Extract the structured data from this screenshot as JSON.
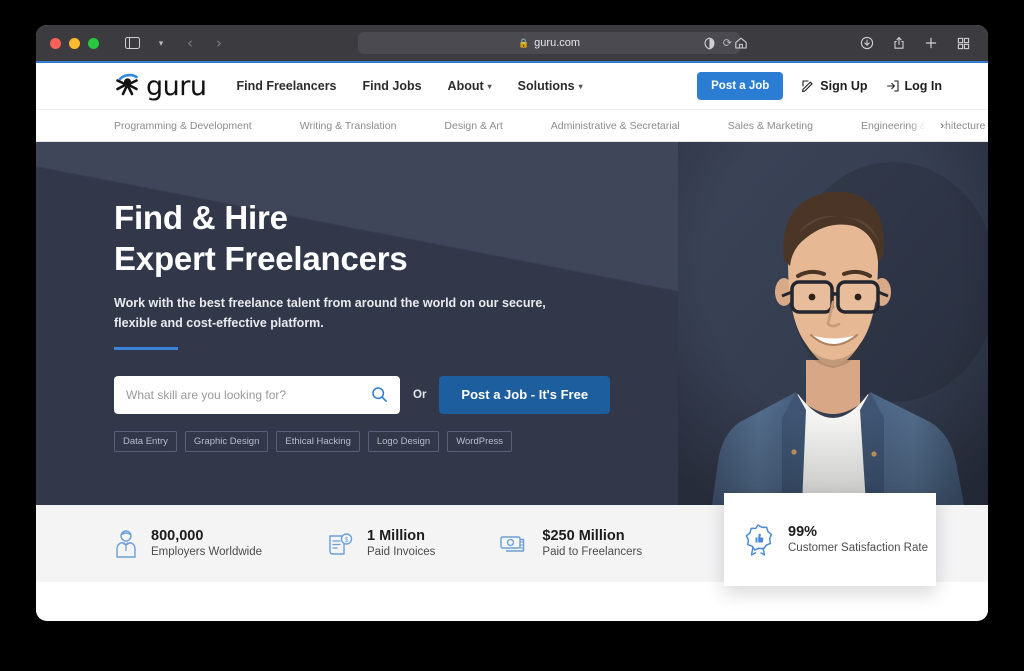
{
  "browser": {
    "url": "guru.com",
    "lock_icon": "lock-icon",
    "reload_icon": "reload-icon",
    "sidebar_icon": "sidebar-toggle-icon",
    "sidebar_caret_icon": "chevron-down-icon",
    "back_icon": "back-arrow-icon",
    "forward_icon": "forward-arrow-icon",
    "reader_icon": "reader-contrast-icon",
    "home_icon": "home-icon",
    "downloads_icon": "downloads-icon",
    "share_icon": "share-icon",
    "newtab_icon": "plus-icon",
    "tabs_icon": "tab-overview-icon"
  },
  "header": {
    "logo_text": "guru",
    "nav": [
      {
        "label": "Find Freelancers",
        "caret": false
      },
      {
        "label": "Find Jobs",
        "caret": false
      },
      {
        "label": "About",
        "caret": true
      },
      {
        "label": "Solutions",
        "caret": true
      }
    ],
    "post_job_label": "Post a Job",
    "signup_label": "Sign Up",
    "login_label": "Log In",
    "accent_color": "#2b7cd3"
  },
  "categories": [
    "Programming & Development",
    "Writing & Translation",
    "Design & Art",
    "Administrative & Secretarial",
    "Sales & Marketing",
    "Engineering & Architecture"
  ],
  "hero": {
    "title_line1": "Find & Hire",
    "title_line2": "Expert Freelancers",
    "subtitle_line1": "Work with the best freelance talent from around the world on our secure,",
    "subtitle_line2": "flexible and cost-effective platform.",
    "search_placeholder": "What skill are you looking for?",
    "search_value": "",
    "search_icon": "search-icon",
    "or_label": "Or",
    "cta_label": "Post a Job - It's Free",
    "tags": [
      "Data Entry",
      "Graphic Design",
      "Ethical Hacking",
      "Logo Design",
      "WordPress"
    ],
    "bg_color": "#373e52",
    "cta_color": "#1c5e9e"
  },
  "stats": [
    {
      "icon": "employer-person-icon",
      "number": "800,000",
      "label": "Employers Worldwide"
    },
    {
      "icon": "invoice-icon",
      "number": "1 Million",
      "label": "Paid Invoices"
    },
    {
      "icon": "money-icon",
      "number": "$250 Million",
      "label": "Paid to Freelancers"
    }
  ],
  "float_card": {
    "icon": "satisfaction-badge-icon",
    "number": "99%",
    "label": "Customer Satisfaction Rate"
  }
}
